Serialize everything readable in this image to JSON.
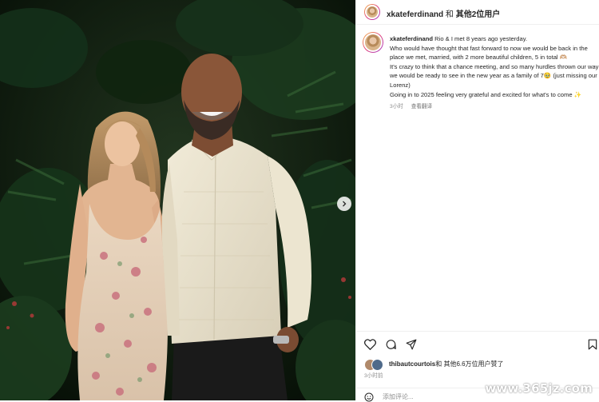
{
  "header": {
    "username": "xkateferdinand",
    "separator": " 和 ",
    "others": "其他2位用户"
  },
  "caption": {
    "username": "xkateferdinand",
    "lines": [
      "Rio & I met 8 years ago yesterday.",
      "Who would have thought that fast forward to now we would be back in the place we met, married, with 2 more beautiful children, 5 in total 🫶🏼",
      "It's crazy to think that a chance meeting, and so many hurdles thrown our way we would be ready to see in the new year as a family of 7🥹 (just missing our Lorenz)",
      "Going in to 2025 feeling very grateful and excited for what's to come ✨"
    ],
    "time": "3小时",
    "translate": "查看翻译"
  },
  "actions": {
    "like": "heart-icon",
    "comment": "comment-icon",
    "share": "share-icon",
    "save": "bookmark-icon"
  },
  "likes": {
    "user": "thibautcourtois",
    "text": "和 其他6.6万位用户赞了"
  },
  "post_time": "3小时前",
  "comment_box": {
    "placeholder": "添加评论..."
  },
  "watermark": "www.365jz.com",
  "colors": {
    "text": "#262626",
    "muted": "#8e8e8e",
    "divider": "#efefef"
  }
}
